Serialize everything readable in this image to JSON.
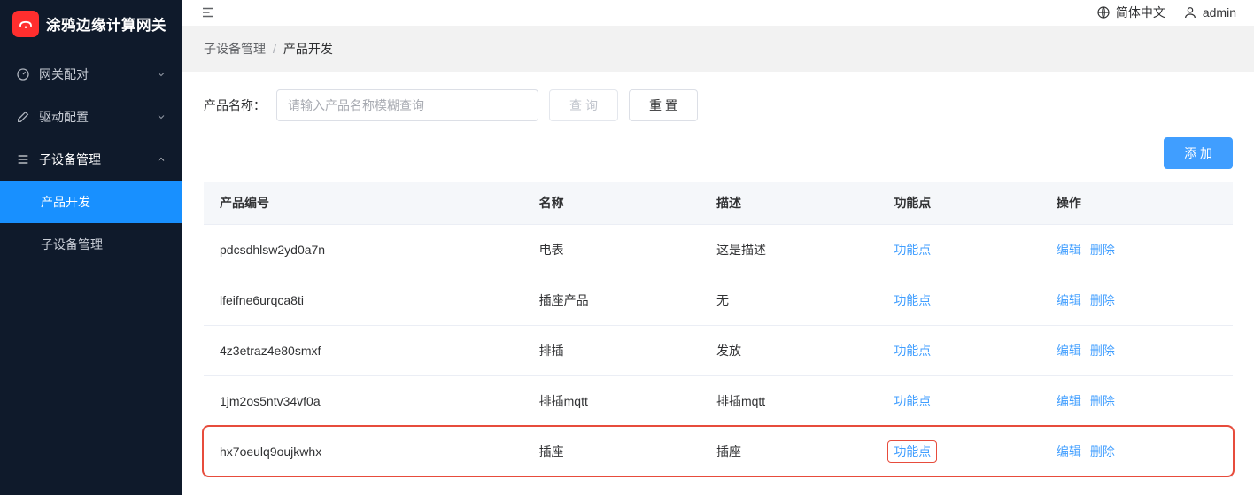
{
  "app": {
    "title": "涂鸦边缘计算网关"
  },
  "sidebar": {
    "items": [
      {
        "label": "网关配对",
        "expanded": false
      },
      {
        "label": "驱动配置",
        "expanded": false
      },
      {
        "label": "子设备管理",
        "expanded": true,
        "children": [
          {
            "label": "产品开发",
            "active": true
          },
          {
            "label": "子设备管理",
            "active": false
          }
        ]
      }
    ]
  },
  "topbar": {
    "language": "简体中文",
    "user": "admin"
  },
  "breadcrumb": {
    "parent": "子设备管理",
    "current": "产品开发"
  },
  "search": {
    "label": "产品名称：",
    "placeholder": "请输入产品名称模糊查询",
    "query_btn": "查询",
    "reset_btn": "重置"
  },
  "toolbar": {
    "add_btn": "添加"
  },
  "table": {
    "headers": {
      "id": "产品编号",
      "name": "名称",
      "desc": "描述",
      "fp": "功能点",
      "ops": "操作"
    },
    "fp_link": "功能点",
    "edit": "编辑",
    "delete": "删除",
    "rows": [
      {
        "id": "pdcsdhlsw2yd0a7n",
        "name": "电表",
        "desc": "这是描述",
        "highlight": false
      },
      {
        "id": "lfeifne6urqca8ti",
        "name": "插座产品",
        "desc": "无",
        "highlight": false
      },
      {
        "id": "4z3etraz4e80smxf",
        "name": "排插",
        "desc": "发放",
        "highlight": false
      },
      {
        "id": "1jm2os5ntv34vf0a",
        "name": "排插mqtt",
        "desc": "排插mqtt",
        "highlight": false
      },
      {
        "id": "hx7oeulq9oujkwhx",
        "name": "插座",
        "desc": "插座",
        "highlight": true
      }
    ]
  }
}
